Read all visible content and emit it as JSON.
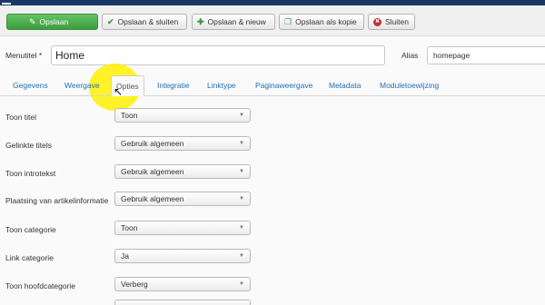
{
  "toolbar": {
    "save": "Opslaan",
    "save_close": "Opslaan & sluiten",
    "save_new": "Opslaan & nieuw",
    "save_copy": "Opslaan als kopie",
    "close": "Sluiten"
  },
  "form": {
    "title_label": "Menutitel *",
    "title_value": "Home",
    "alias_label": "Alias",
    "alias_value": "homepage"
  },
  "tabs": [
    "Gegevens",
    "Weergave",
    "Opties",
    "Integratie",
    "Linktype",
    "Paginaweergave",
    "Metadata",
    "Moduletoewijzing"
  ],
  "active_tab": "Opties",
  "options": [
    {
      "label": "Toon titel",
      "value": "Toon"
    },
    {
      "label": "Gelinkte titels",
      "value": "Gebruik algemeen"
    },
    {
      "label": "Toon introtekst",
      "value": "Gebruik algemeen"
    },
    {
      "label": "Plaatsing van artikelinformatie",
      "value": "Gebruik algemeen"
    },
    {
      "label": "Toon categorie",
      "value": "Toon"
    },
    {
      "label": "Link categorie",
      "value": "Ja"
    },
    {
      "label": "Toon hoofdcategorie",
      "value": "Verberg"
    }
  ],
  "colors": {
    "topbar": "#1a3867",
    "save_button": "#46a546",
    "tab_link": "#1f6fb5",
    "highlight": "#fff000"
  }
}
